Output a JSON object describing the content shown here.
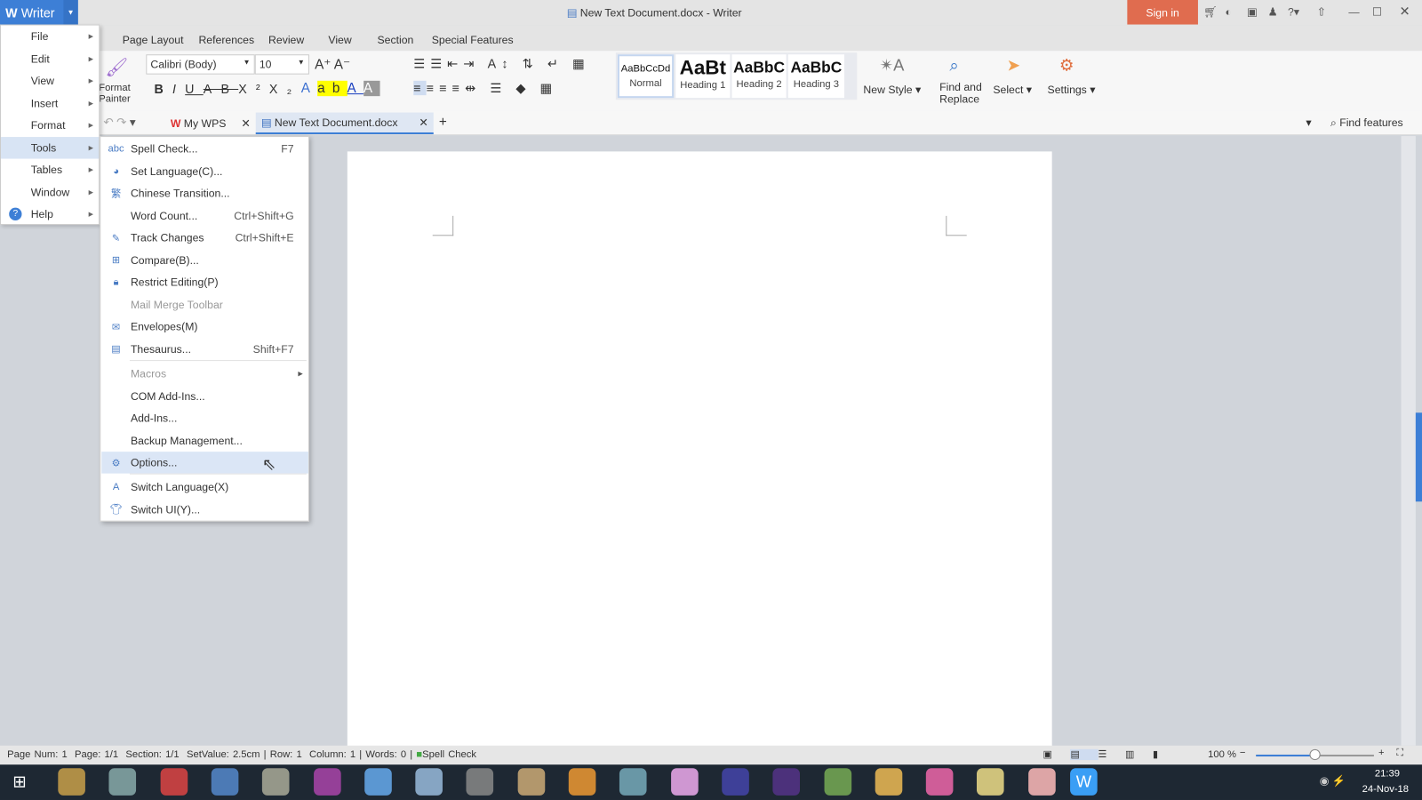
{
  "app": {
    "name": "Writer",
    "title": "New Text Document.docx - Writer",
    "sign_in": "Sign in"
  },
  "menu_tabs": [
    "Page Layout",
    "References",
    "Review",
    "View",
    "Section",
    "Special Features"
  ],
  "ribbon": {
    "format_painter": "Format Painter",
    "font": "Calibri (Body)",
    "size": "10",
    "styles": [
      {
        "preview": "AaBbCcDd",
        "label": "Normal"
      },
      {
        "preview": "AaBt",
        "label": "Heading 1"
      },
      {
        "preview": "AaBbC",
        "label": "Heading 2"
      },
      {
        "preview": "AaBbC",
        "label": "Heading 3"
      }
    ],
    "new_style": "New Style",
    "find_replace": "Find and Replace",
    "select": "Select",
    "settings": "Settings"
  },
  "tabs": {
    "my_wps": "My WPS",
    "doc": "New Text Document.docx",
    "find_features": "Find features"
  },
  "main_menu": [
    {
      "label": "File"
    },
    {
      "label": "Edit"
    },
    {
      "label": "View"
    },
    {
      "label": "Insert"
    },
    {
      "label": "Format"
    },
    {
      "label": "Tools"
    },
    {
      "label": "Tables"
    },
    {
      "label": "Window"
    },
    {
      "label": "Help"
    }
  ],
  "tools_menu": [
    {
      "label": "Spell Check...",
      "shortcut": "F7",
      "icon": "spell-check-icon"
    },
    {
      "label": "Set Language(C)...",
      "shortcut": "",
      "icon": "language-icon"
    },
    {
      "label": "Chinese Transition...",
      "shortcut": "",
      "icon": "chinese-transition-icon"
    },
    {
      "label": "Word Count...",
      "shortcut": "Ctrl+Shift+G",
      "icon": ""
    },
    {
      "label": "Track Changes",
      "shortcut": "Ctrl+Shift+E",
      "icon": "track-changes-icon"
    },
    {
      "label": "Compare(B)...",
      "shortcut": "",
      "icon": "compare-icon"
    },
    {
      "label": "Restrict Editing(P)",
      "shortcut": "",
      "icon": "lock-document-icon"
    },
    {
      "label": "Mail Merge Toolbar",
      "shortcut": "",
      "icon": "",
      "disabled": true
    },
    {
      "label": "Envelopes(M)",
      "shortcut": "",
      "icon": "envelope-icon"
    },
    {
      "label": "Thesaurus...",
      "shortcut": "Shift+F7",
      "icon": "thesaurus-icon"
    },
    {
      "label": "Macros",
      "shortcut": "",
      "icon": "",
      "disabled": true
    },
    {
      "label": "COM Add-Ins...",
      "shortcut": "",
      "icon": ""
    },
    {
      "label": "Add-Ins...",
      "shortcut": "",
      "icon": ""
    },
    {
      "label": "Backup Management...",
      "shortcut": "",
      "icon": ""
    },
    {
      "label": "Options...",
      "shortcut": "",
      "icon": "gear-icon"
    },
    {
      "label": "Switch Language(X)",
      "shortcut": "",
      "icon": "switch-language-icon"
    },
    {
      "label": "Switch UI(Y)...",
      "shortcut": "",
      "icon": "shirt-icon"
    }
  ],
  "status": {
    "page_num": "Page Num: 1",
    "page": "Page: 1/1",
    "section": "Section: 1/1",
    "set_value": "SetValue: 2.5cm",
    "row": "Row: 1",
    "column": "Column: 1",
    "words": "Words: 0",
    "spell_check": "Spell Check",
    "zoom": "100 %",
    "zoom_level": 100
  },
  "taskbar": {
    "time": "21:39",
    "date": "24-Nov-18"
  },
  "colors": {
    "accent": "#3d7fd6",
    "sign_in": "#e06c4f",
    "menu_highlight": "#dbe6f6"
  }
}
